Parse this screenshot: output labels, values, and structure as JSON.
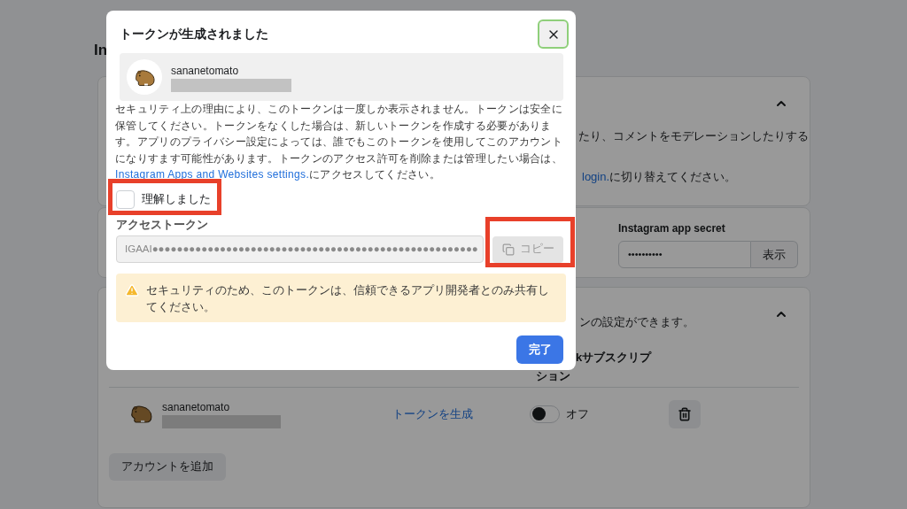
{
  "background": {
    "heading": "In",
    "permissions_card": {
      "expanded": true,
      "text": "たり、コメントをモデレーションしたりする",
      "link": "login.",
      "link_suffix": "に切り替えてください。"
    },
    "secret_card": {
      "label": "Instagram app secret",
      "value": "••••••••••",
      "button": "表示"
    },
    "accounts_card": {
      "expanded": true,
      "text": "ンの設定ができます。",
      "column_heading_1": "kサブスクリプ",
      "column_heading_2": "ション",
      "accounts": [
        {
          "name": "sananetomato",
          "action": "トークンを生成",
          "subscribed": false,
          "toggle_label": "オフ"
        }
      ],
      "add_button": "アカウントを追加"
    }
  },
  "dialog": {
    "title": "トークンが生成されました",
    "account": {
      "name": "sananetomato"
    },
    "notice": "セキュリティ上の理由により、このトークンは一度しか表示されません。トークンは安全に保管してください。トークンをなくした場合は、新しいトークンを作成する必要があります。アプリのプライバシー設定によっては、誰でもこのトークンを使用してこのアカウントになりすます可能性があります。トークンのアクセス許可を削除または管理したい場合は、",
    "notice_link": "Instagram Apps and Websites settings.",
    "notice_suffix": "にアクセスしてください。",
    "confirm": {
      "label": "理解しました",
      "checked": false
    },
    "token_label": "アクセストークン",
    "token": "IGAAI●●●●●●●●●●●●●●●●●●●●●●●●●●●●●●●●●●●●●●●●●●●●●●●●●●●●●",
    "copy_button": {
      "label": "コピー",
      "disabled": true
    },
    "warning": "セキュリティのため、このトークンは、信頼できるアプリ開発者とのみ共有してください。",
    "done_button": "完了"
  }
}
